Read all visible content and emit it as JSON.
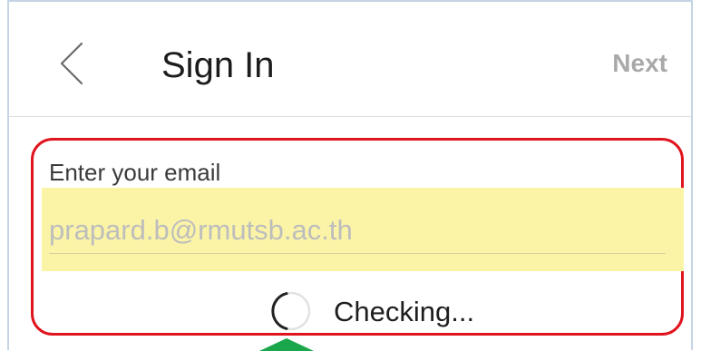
{
  "header": {
    "title": "Sign In",
    "next_label": "Next"
  },
  "email": {
    "label": "Enter your email",
    "value": "prapard.b@rmutsb.ac.th"
  },
  "status": {
    "text": "Checking..."
  },
  "icons": {
    "back": "chevron-left-icon",
    "spinner": "loading-spinner-icon",
    "annotation": "annotation-arrow-icon"
  },
  "colors": {
    "highlight_border": "#e0141e",
    "field_background": "#fbf4a7",
    "arrow": "#1aa64a",
    "next_text": "#a9a9a9"
  }
}
